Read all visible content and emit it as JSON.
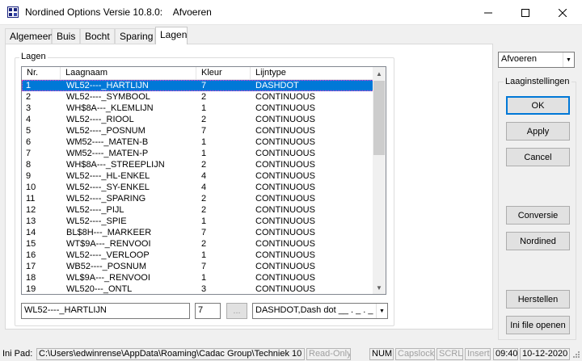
{
  "window": {
    "title": "Nordined Options Versie 10.8.0:    Afvoeren",
    "controls": {
      "minimize": "—",
      "maximize": "☐",
      "close": "✕"
    }
  },
  "tabs": [
    "Algemeen",
    "Buis",
    "Bocht",
    "Sparing",
    "Lagen"
  ],
  "active_tab": "Lagen",
  "lagen": {
    "group_label": "Lagen",
    "columns": [
      "Nr.",
      "Laagnaam",
      "Kleur",
      "Lijntype"
    ],
    "rows": [
      {
        "nr": "1",
        "naam": "WL52----_HARTLIJN",
        "kleur": "7",
        "type": "DASHDOT"
      },
      {
        "nr": "2",
        "naam": "WL52----_SYMBOOL",
        "kleur": "2",
        "type": "CONTINUOUS"
      },
      {
        "nr": "3",
        "naam": "WH$8A---_KLEMLIJN",
        "kleur": "1",
        "type": "CONTINUOUS"
      },
      {
        "nr": "4",
        "naam": "WL52----_RIOOL",
        "kleur": "2",
        "type": "CONTINUOUS"
      },
      {
        "nr": "5",
        "naam": "WL52----_POSNUM",
        "kleur": "7",
        "type": "CONTINUOUS"
      },
      {
        "nr": "6",
        "naam": "WM52----_MATEN-B",
        "kleur": "1",
        "type": "CONTINUOUS"
      },
      {
        "nr": "7",
        "naam": "WM52----_MATEN-P",
        "kleur": "1",
        "type": "CONTINUOUS"
      },
      {
        "nr": "8",
        "naam": "WH$8A---_STREEPLIJN",
        "kleur": "2",
        "type": "CONTINUOUS"
      },
      {
        "nr": "9",
        "naam": "WL52----_HL-ENKEL",
        "kleur": "4",
        "type": "CONTINUOUS"
      },
      {
        "nr": "10",
        "naam": "WL52----_SY-ENKEL",
        "kleur": "4",
        "type": "CONTINUOUS"
      },
      {
        "nr": "11",
        "naam": "WL52----_SPARING",
        "kleur": "2",
        "type": "CONTINUOUS"
      },
      {
        "nr": "12",
        "naam": "WL52----_PIJL",
        "kleur": "2",
        "type": "CONTINUOUS"
      },
      {
        "nr": "13",
        "naam": "WL52----_SPIE",
        "kleur": "1",
        "type": "CONTINUOUS"
      },
      {
        "nr": "14",
        "naam": "BL$8H---_MARKEER",
        "kleur": "7",
        "type": "CONTINUOUS"
      },
      {
        "nr": "15",
        "naam": "WT$9A---_RENVOOI",
        "kleur": "2",
        "type": "CONTINUOUS"
      },
      {
        "nr": "16",
        "naam": "WL52----_VERLOOP",
        "kleur": "1",
        "type": "CONTINUOUS"
      },
      {
        "nr": "17",
        "naam": "WB52----_POSNUM",
        "kleur": "7",
        "type": "CONTINUOUS"
      },
      {
        "nr": "18",
        "naam": "WL$9A---_RENVOOI",
        "kleur": "1",
        "type": "CONTINUOUS"
      },
      {
        "nr": "19",
        "naam": "WL520---_ONTL",
        "kleur": "3",
        "type": "CONTINUOUS"
      }
    ],
    "selected_row": 0,
    "edit_name": "WL52----_HARTLIJN",
    "edit_color": "7",
    "browse_button": "...",
    "linetype_value": "DASHDOT,Dash dot __ . _ . _"
  },
  "right_panel": {
    "context_combo": "Afvoeren",
    "group_label": "Laaginstellingen",
    "buttons": [
      "OK",
      "Apply",
      "Cancel",
      "Conversie",
      "Nordined",
      "Herstellen",
      "Ini file openen"
    ]
  },
  "statusbar": {
    "label": "Ini Pad:",
    "path": "C:\\Users\\edwinrense\\AppData\\Roaming\\Cadac Group\\Techniek 10",
    "readonly": "Read-Only",
    "num": "NUM",
    "capslock": "Capslock",
    "scrl": "SCRL",
    "insert": "Insert",
    "time": "09:40",
    "date": "10-12-2020"
  },
  "colors": {
    "selection": "#0078d7",
    "default_button_border": "#0078d7"
  }
}
